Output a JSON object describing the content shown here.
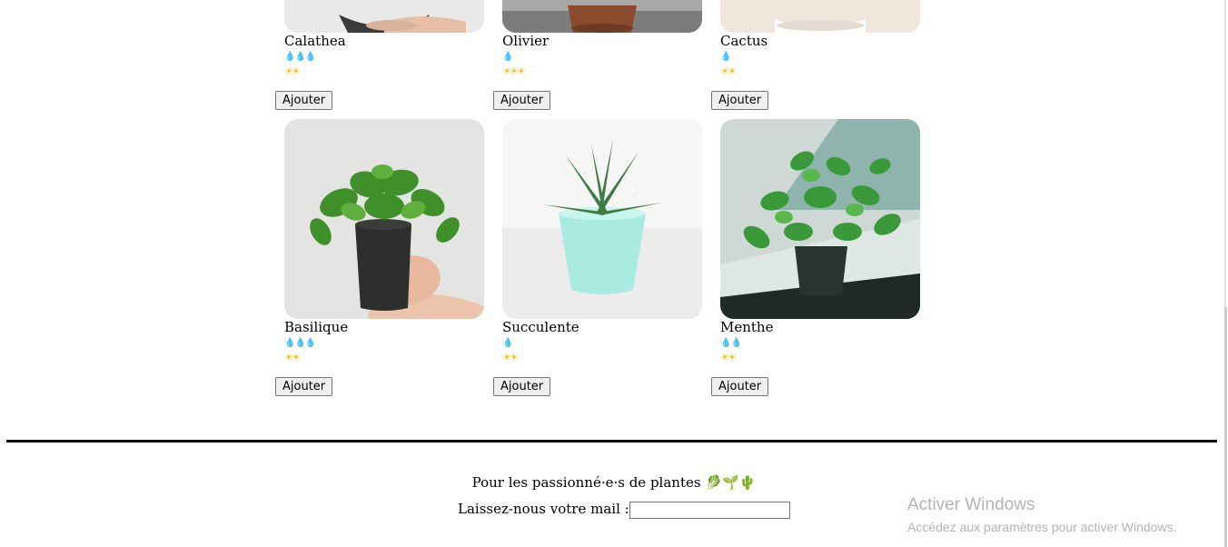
{
  "plants": [
    {
      "name": "Calathea",
      "water": "💧💧💧",
      "light": "☀☀",
      "button": "Ajouter"
    },
    {
      "name": "Olivier",
      "water": "💧",
      "light": "☀☀☀",
      "button": "Ajouter"
    },
    {
      "name": "Cactus",
      "water": "💧",
      "light": "☀☀",
      "button": "Ajouter"
    },
    {
      "name": "Basilique",
      "water": "💧💧💧",
      "light": "☀☀",
      "button": "Ajouter"
    },
    {
      "name": "Succulente",
      "water": "💧",
      "light": "☀☀",
      "button": "Ajouter"
    },
    {
      "name": "Menthe",
      "water": "💧💧",
      "light": "☀☀",
      "button": "Ajouter"
    }
  ],
  "footer": {
    "tagline": "Pour les passionné·e·s de plantes",
    "emojis": "🥬🌱🌵",
    "mail_label": "Laissez-nous votre mail :",
    "mail_value": ""
  },
  "watermark": {
    "title": "Activer Windows",
    "subtitle": "Accédez aux paramètres pour activer Windows."
  },
  "colors": {
    "water": "#3a8fd6",
    "sun": "#f5b800",
    "footer_rule": "#000000"
  }
}
